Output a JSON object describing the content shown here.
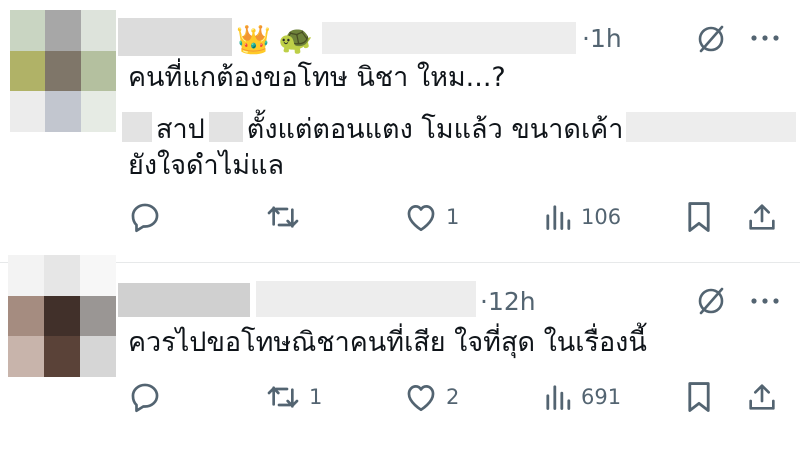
{
  "posts": [
    {
      "time": "·1h",
      "text_line1": "คนที่แกต้องขอโทษ นิชา ใหม...?",
      "text_line2_a": "สาป",
      "text_line2_b": "ตั้งแต่ตอนแตง โมแล้ว ขนาดเค้า",
      "text_line3": "ยังใจดำไม่แล",
      "emojis": [
        "👑",
        "🐢"
      ],
      "counts": {
        "replies": "",
        "reposts": "",
        "likes": "1",
        "views": "106"
      }
    },
    {
      "time": "·12h",
      "text_line1": "ควรไปขอโทษณิชาคนที่เสีย ใจที่สุด ในเรื่องนี้",
      "counts": {
        "replies": "",
        "reposts": "1",
        "likes": "2",
        "views": "691"
      }
    }
  ],
  "icons": {
    "reply": "reply-icon",
    "repost": "repost-icon",
    "like": "heart-icon",
    "views": "views-icon",
    "bookmark": "bookmark-icon",
    "share": "share-icon",
    "grok": "grok-icon",
    "more": "more-icon"
  },
  "colors": {
    "text": "#0f1419",
    "muted": "#536471",
    "divider": "#e7e9ea"
  }
}
